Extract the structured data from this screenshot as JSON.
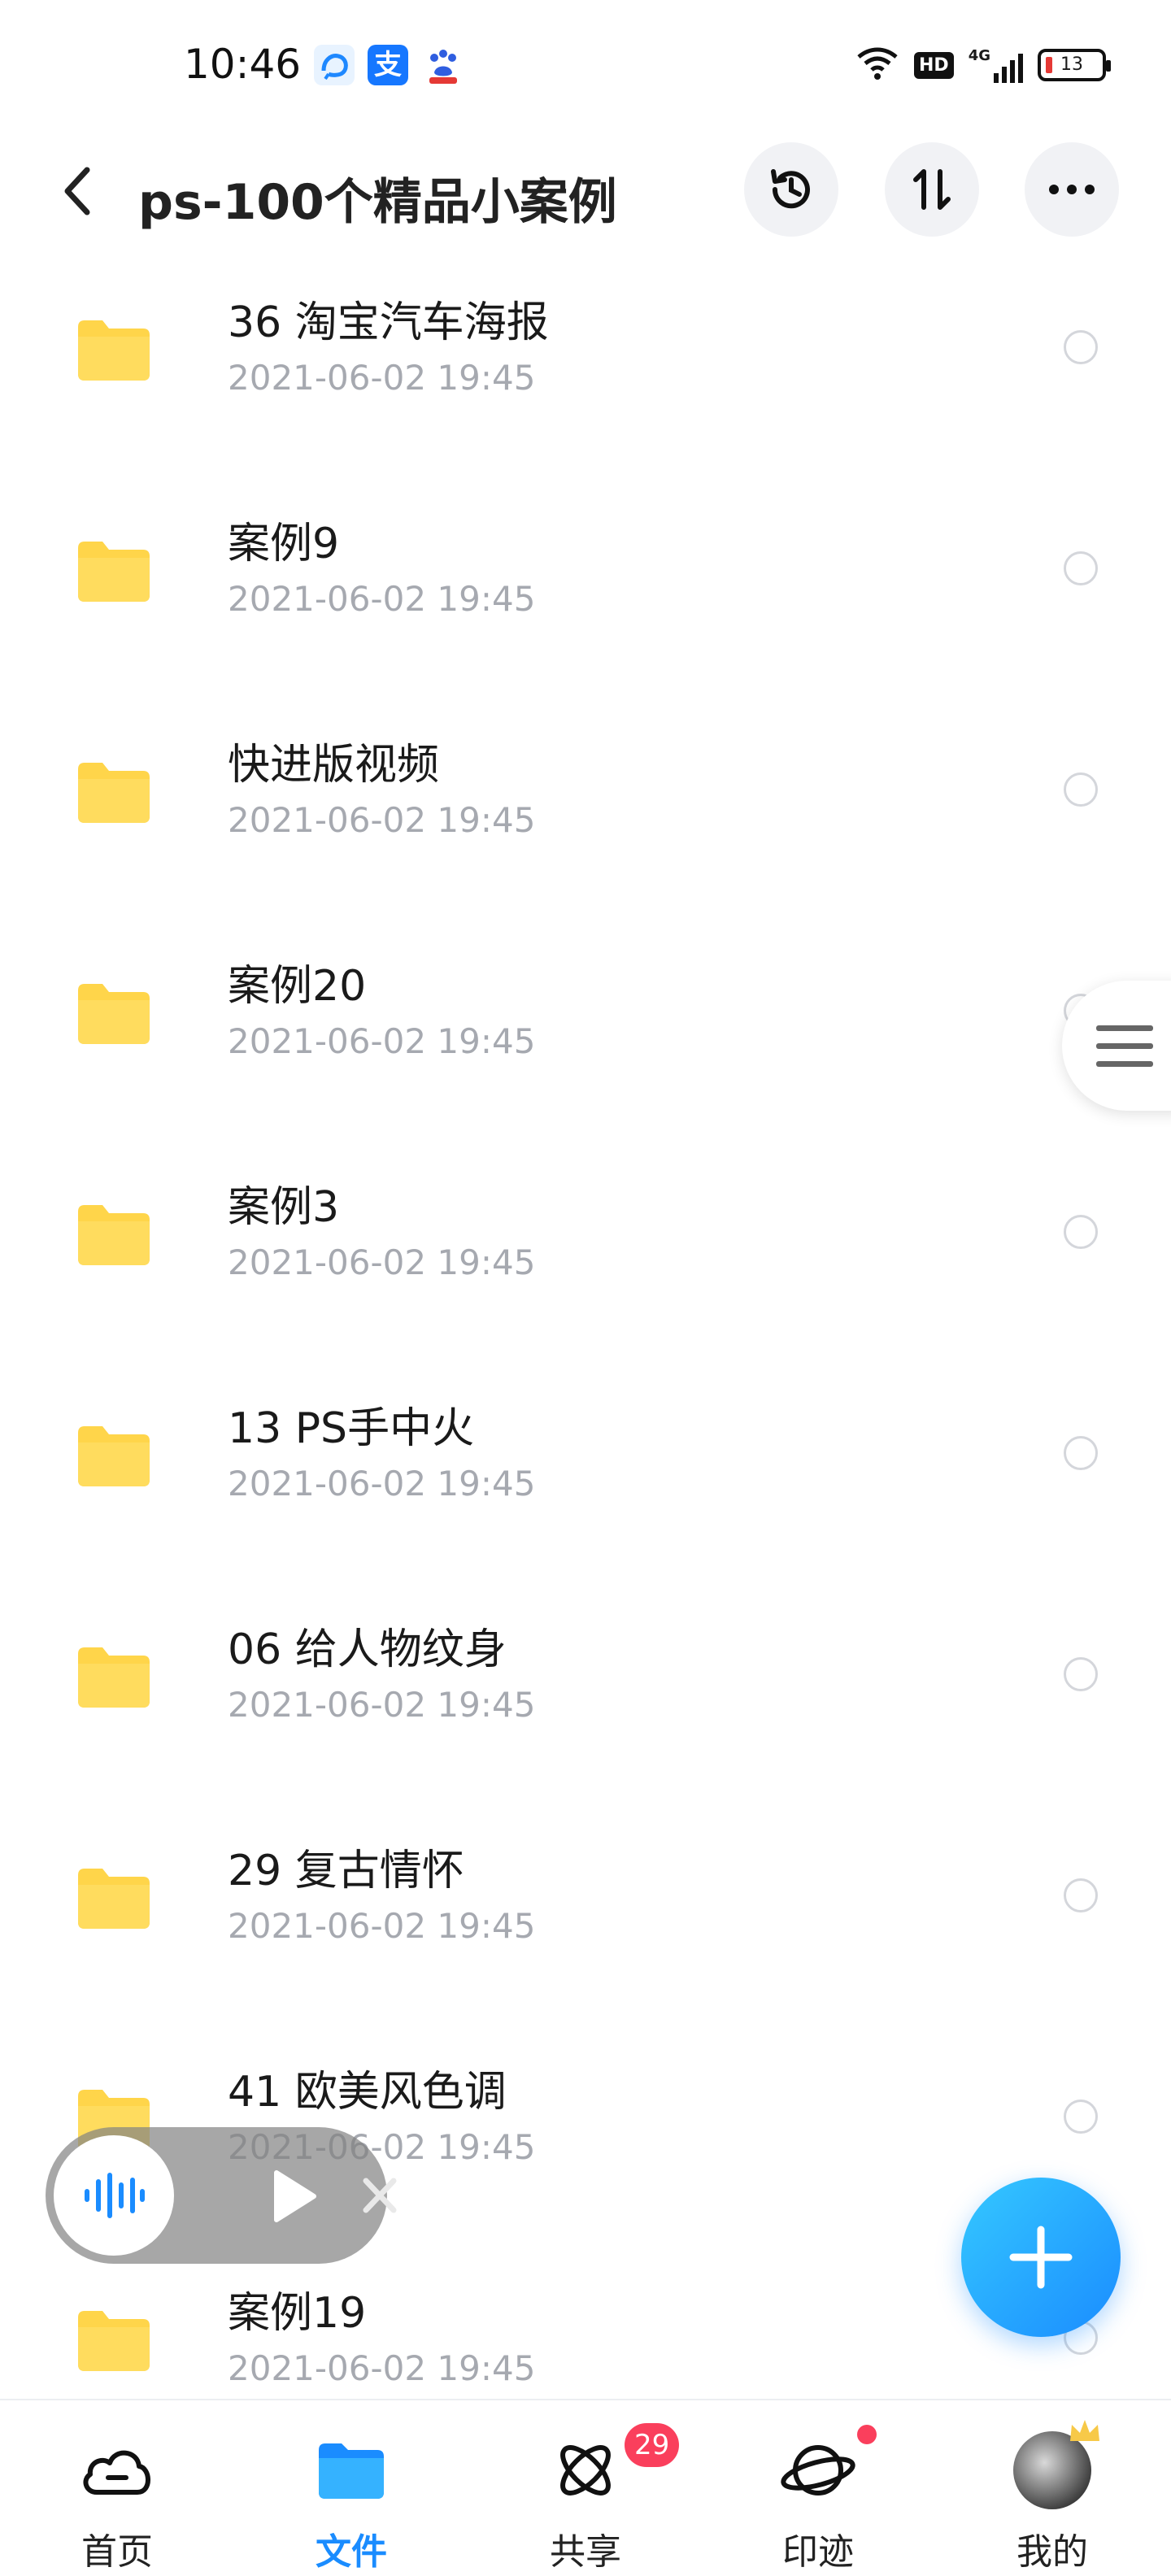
{
  "status_bar": {
    "time": "10:46",
    "network": "4G",
    "hd_label": "HD",
    "battery_level": "13",
    "app_icons": [
      "qq-browser-icon",
      "alipay-icon",
      "baidu-icon"
    ]
  },
  "header": {
    "title": "ps-100个精品小案例",
    "buttons": [
      "back",
      "history",
      "sort",
      "more"
    ]
  },
  "files": [
    {
      "name": "36 淘宝汽车海报",
      "date": "2021-06-02  19:45"
    },
    {
      "name": "案例9",
      "date": "2021-06-02  19:45"
    },
    {
      "name": "快进版视频",
      "date": "2021-06-02  19:45"
    },
    {
      "name": "案例20",
      "date": "2021-06-02  19:45"
    },
    {
      "name": "案例3",
      "date": "2021-06-02  19:45"
    },
    {
      "name": "13 PS手中火",
      "date": "2021-06-02  19:45"
    },
    {
      "name": "06 给人物纹身",
      "date": "2021-06-02  19:45"
    },
    {
      "name": "29 复古情怀",
      "date": "2021-06-02  19:45"
    },
    {
      "name": "41 欧美风色调",
      "date": "2021-06-02  19:45"
    },
    {
      "name": "案例19",
      "date": "2021-06-02  19:45"
    }
  ],
  "bottom_nav": {
    "tabs": [
      {
        "label": "首页",
        "icon": "cloud-icon"
      },
      {
        "label": "文件",
        "icon": "folder-icon",
        "active": true
      },
      {
        "label": "共享",
        "icon": "atom-icon",
        "badge": "29"
      },
      {
        "label": "印迹",
        "icon": "planet-icon",
        "dot": true
      },
      {
        "label": "我的",
        "icon": "avatar"
      }
    ]
  },
  "colors": {
    "accent": "#1a8cff",
    "folder": "#ffd54a",
    "badge": "#fa3f5c",
    "date_text": "#a6a9b0"
  }
}
